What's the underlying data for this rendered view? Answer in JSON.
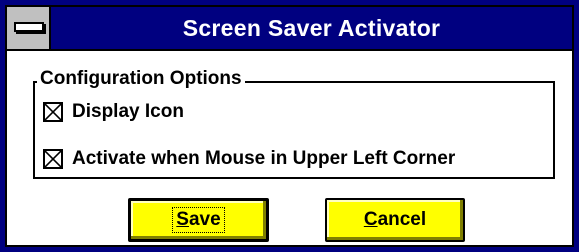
{
  "window": {
    "title": "Screen Saver Activator",
    "title_bar_color": "#000080",
    "system_menu_icon": "system-menu-icon"
  },
  "config": {
    "group_label": "Configuration Options",
    "options": [
      {
        "label": "Display Icon",
        "checked": true
      },
      {
        "label": "Activate when Mouse in Upper Left Corner",
        "checked": true
      }
    ]
  },
  "buttons": {
    "save": {
      "accel": "S",
      "rest": "ave",
      "color": "#ffff00",
      "default": true
    },
    "cancel": {
      "accel": "C",
      "rest": "ancel",
      "color": "#ffff00"
    }
  }
}
